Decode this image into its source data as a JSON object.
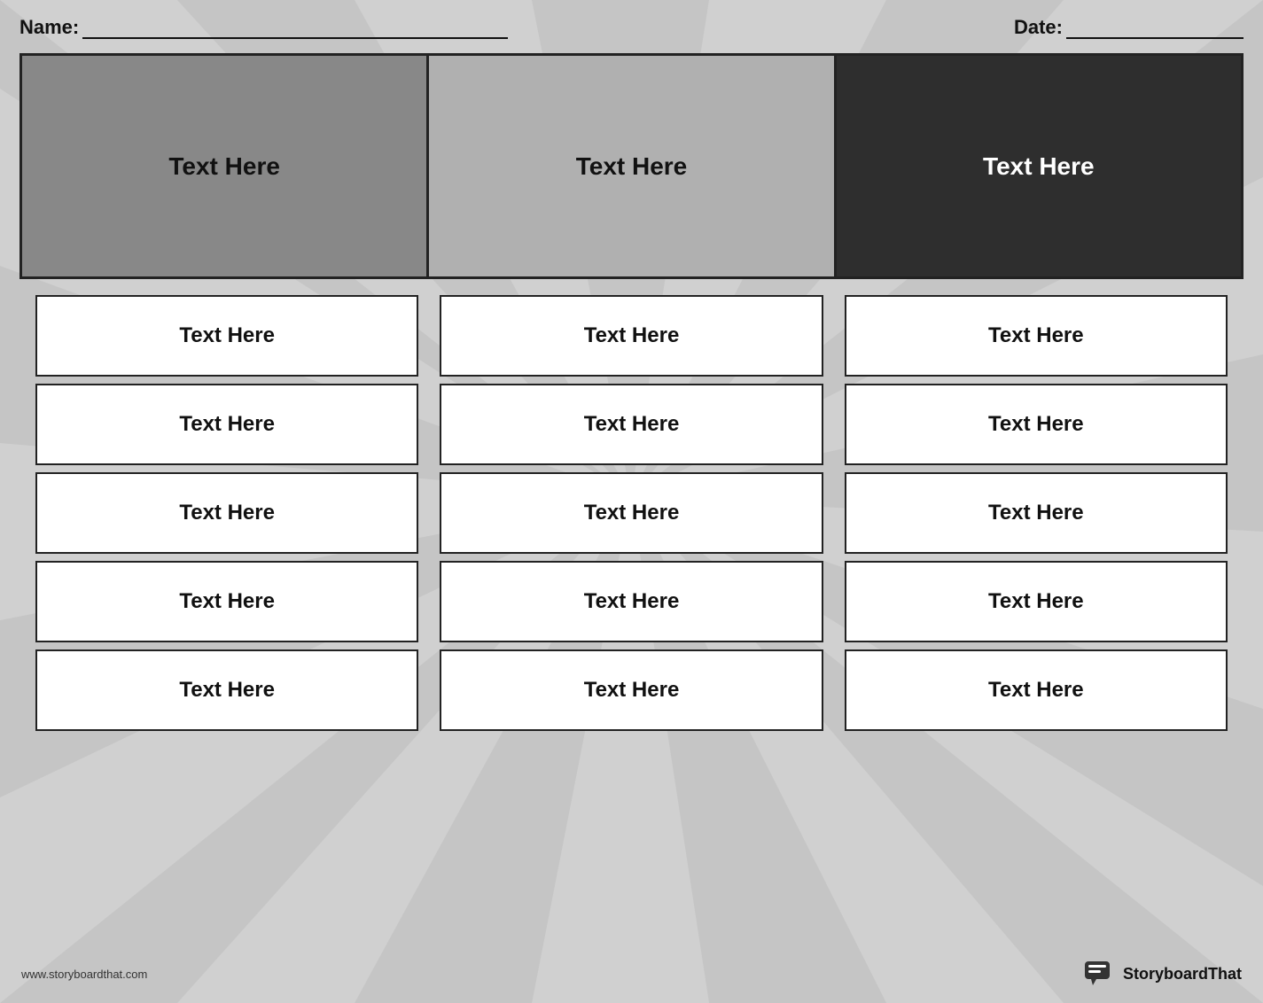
{
  "header": {
    "name_label": "Name:",
    "date_label": "Date:"
  },
  "top_panels": [
    {
      "text": "Text Here",
      "bg": "#888",
      "color": "#111"
    },
    {
      "text": "Text Here",
      "bg": "#b0b0b0",
      "color": "#111"
    },
    {
      "text": "Text Here",
      "bg": "#2e2e2e",
      "color": "#fff"
    }
  ],
  "grid": {
    "columns": [
      {
        "cells": [
          "Text Here",
          "Text Here",
          "Text Here",
          "Text Here",
          "Text Here"
        ]
      },
      {
        "cells": [
          "Text Here",
          "Text Here",
          "Text Here",
          "Text Here",
          "Text Here"
        ]
      },
      {
        "cells": [
          "Text Here",
          "Text Here",
          "Text Here",
          "Text Here",
          "Text Here"
        ]
      }
    ]
  },
  "footer": {
    "url": "www.storyboardthat.com",
    "brand": "StoryboardThat"
  }
}
